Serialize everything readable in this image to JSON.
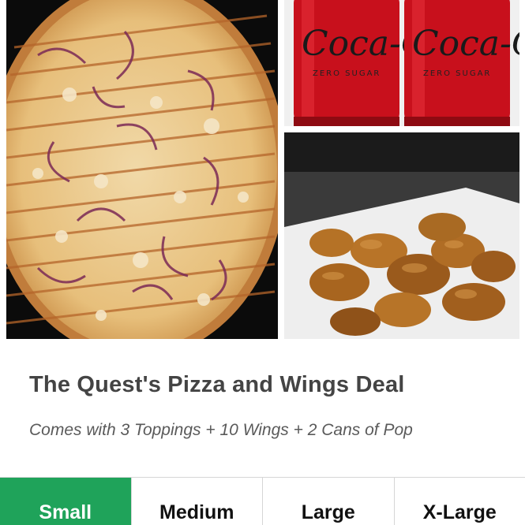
{
  "deal": {
    "title": "The Quest's Pizza and Wings Deal",
    "description": "Comes with 3 Toppings + 10 Wings + 2 Cans of Pop"
  },
  "images": {
    "pizza": "pizza-photo",
    "cans": "soda-cans-photo",
    "wings": "chicken-wings-photo",
    "can_brand_text": "Coca-Cola",
    "can_variant_text": "ZERO SUGAR"
  },
  "sizes": [
    {
      "label": "Small",
      "selected": true
    },
    {
      "label": "Medium",
      "selected": false
    },
    {
      "label": "Large",
      "selected": false
    },
    {
      "label": "X-Large",
      "selected": false
    }
  ],
  "colors": {
    "accent": "#1fa35a",
    "can_red": "#c8101c",
    "title_text": "#444444"
  }
}
